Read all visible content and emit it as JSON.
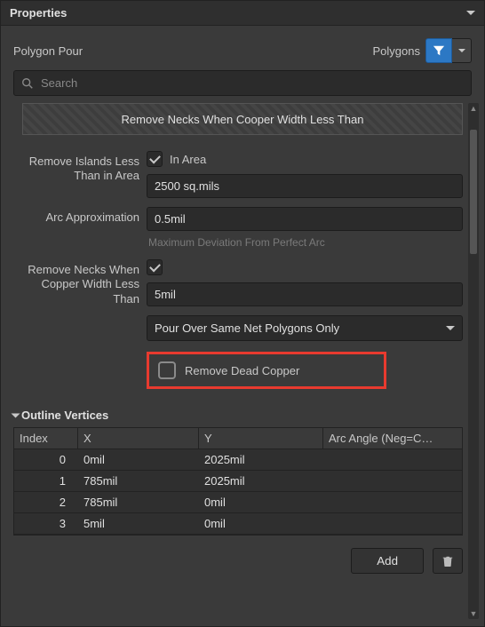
{
  "panelTitle": "Properties",
  "objectType": "Polygon Pour",
  "filterLabel": "Polygons",
  "searchPlaceholder": "Search",
  "banner": "Remove Necks When Cooper Width Less Than",
  "form": {
    "inAreaLabel": "In Area",
    "inAreaChecked": true,
    "removeIslandsLabel": "Remove Islands Less Than in Area",
    "removeIslandsValue": "2500 sq.mils",
    "arcApproxLabel": "Arc Approximation",
    "arcApproxValue": "0.5mil",
    "arcApproxHint": "Maximum Deviation From Perfect Arc",
    "removeNecksLabel": "Remove Necks When Copper Width Less Than",
    "removeNecksChecked": true,
    "removeNecksValue": "5mil",
    "pourOverValue": "Pour Over Same Net Polygons Only",
    "removeDeadCopperLabel": "Remove Dead Copper",
    "removeDeadCopperChecked": false
  },
  "verticesSection": {
    "title": "Outline Vertices",
    "columns": {
      "index": "Index",
      "x": "X",
      "y": "Y",
      "arc": "Arc Angle (Neg=C…"
    },
    "rows": [
      {
        "index": "0",
        "x": "0mil",
        "y": "2025mil",
        "arc": ""
      },
      {
        "index": "1",
        "x": "785mil",
        "y": "2025mil",
        "arc": ""
      },
      {
        "index": "2",
        "x": "785mil",
        "y": "0mil",
        "arc": ""
      },
      {
        "index": "3",
        "x": "5mil",
        "y": "0mil",
        "arc": ""
      }
    ],
    "addLabel": "Add"
  }
}
